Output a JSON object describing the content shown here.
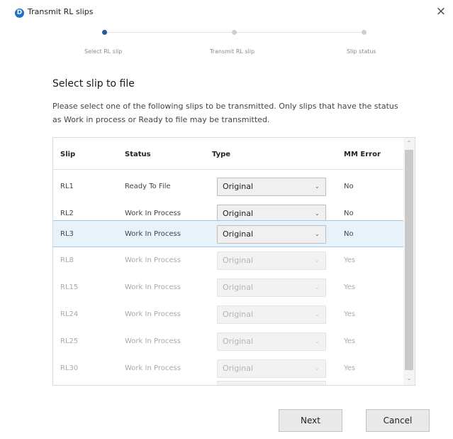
{
  "window": {
    "title": "Transmit RL slips",
    "app_icon_glyph": "D",
    "close_glyph": "×"
  },
  "stepper": {
    "steps": [
      {
        "label": "Select RL slip",
        "state": "active"
      },
      {
        "label": "Transmit RL slip",
        "state": "inactive"
      },
      {
        "label": "Slip status",
        "state": "inactive"
      }
    ]
  },
  "section": {
    "title": "Select slip to file",
    "description": "Please select one of the following slips to be transmitted. Only slips that have the status as Work in process or Ready to file may be transmitted."
  },
  "table": {
    "headers": [
      "Slip",
      "Status",
      "Type",
      "MM Error"
    ],
    "rows": [
      {
        "slip": "RL1",
        "status": "Ready To File",
        "type": "Original",
        "mm_error": "No",
        "enabled": true,
        "selected": false
      },
      {
        "slip": "RL2",
        "status": "Work In Process",
        "type": "Original",
        "mm_error": "No",
        "enabled": true,
        "selected": false
      },
      {
        "slip": "RL3",
        "status": "Work In Process",
        "type": "Original",
        "mm_error": "No",
        "enabled": true,
        "selected": true
      },
      {
        "slip": "RL8",
        "status": "Work In Process",
        "type": "Original",
        "mm_error": "Yes",
        "enabled": false,
        "selected": false
      },
      {
        "slip": "RL15",
        "status": "Work In Process",
        "type": "Original",
        "mm_error": "Yes",
        "enabled": false,
        "selected": false
      },
      {
        "slip": "RL24",
        "status": "Work In Process",
        "type": "Original",
        "mm_error": "Yes",
        "enabled": false,
        "selected": false
      },
      {
        "slip": "RL25",
        "status": "Work In Process",
        "type": "Original",
        "mm_error": "Yes",
        "enabled": false,
        "selected": false
      },
      {
        "slip": "RL30",
        "status": "Work In Process",
        "type": "Original",
        "mm_error": "Yes",
        "enabled": false,
        "selected": false
      },
      {
        "slip": "",
        "status": "",
        "type": "",
        "mm_error": "",
        "enabled": false,
        "selected": false
      }
    ]
  },
  "buttons": {
    "next": "Next",
    "cancel": "Cancel"
  },
  "icons": {
    "dropdown": "chevron-down-icon",
    "close": "close-icon",
    "scroll_up": "scroll-up-icon",
    "scroll_down": "scroll-down-icon"
  },
  "colors": {
    "accent": "#2b5797",
    "selected_row_bg": "#e8f2fb",
    "selected_row_border": "#9fc8ea"
  }
}
